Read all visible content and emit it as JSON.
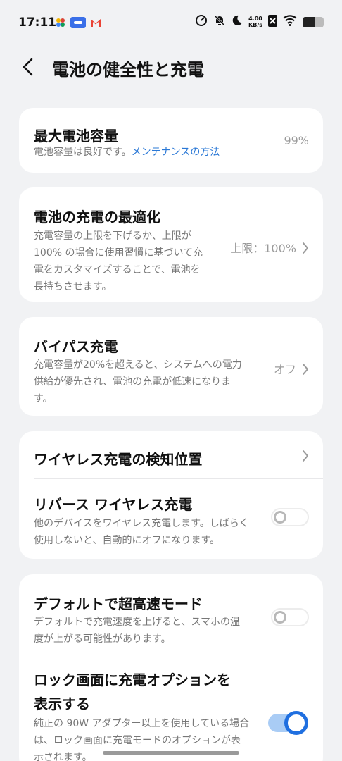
{
  "status": {
    "time": "17:11",
    "net_speed_value": "4.00",
    "net_speed_unit": "KB/s"
  },
  "header": {
    "title": "電池の健全性と充電"
  },
  "cards": {
    "max_capacity": {
      "title": "最大電池容量",
      "desc": "電池容量は良好です。",
      "link": "メンテナンスの方法",
      "value": "99%"
    },
    "optimize": {
      "title": "電池の充電の最適化",
      "desc_lines": [
        "充電容量の上限を下げるか、上限が",
        "100% の場合に使用習慣に基づいて充",
        "電をカスタマイズすることで、電池を",
        "長持ちさせます。"
      ],
      "value": "上限：100%"
    },
    "bypass": {
      "title": "バイパス充電",
      "desc_lines": [
        "充電容量が20%を超えると、システムへの電力",
        "供給が優先され、電池の充電が低速になりま",
        "す。"
      ],
      "value": "オフ"
    },
    "wireless": {
      "detect_title": "ワイヤレス充電の検知位置",
      "reverse_title": "リバース ワイヤレス充電",
      "reverse_desc_lines": [
        "他のデバイスをワイヤレス充電します。しばらく",
        "使用しないと、自動的にオフになります。"
      ],
      "reverse_enabled": false
    },
    "fast": {
      "default_title": "デフォルトで超高速モード",
      "default_desc_lines": [
        "デフォルトで充電速度を上げると、スマホの温",
        "度が上がる可能性があります。"
      ],
      "default_enabled": false,
      "lock_title_lines": [
        "ロック画面に充電オプションを",
        "表示する"
      ],
      "lock_desc_lines": [
        "純正の 90W アダプター以上を使用している場合",
        "は、ロック画面に充電モードのオプションが表",
        "示されます。"
      ],
      "lock_enabled": true
    }
  },
  "colors": {
    "accent": "#1f6fe0",
    "link": "#2a78d6",
    "background": "#f1f2f4"
  }
}
